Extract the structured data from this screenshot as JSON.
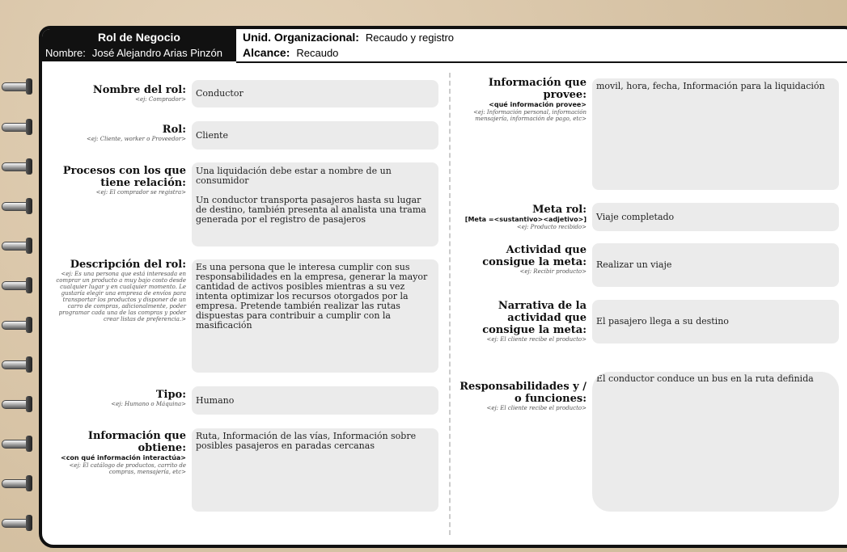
{
  "header": {
    "role_title": "Rol de Negocio",
    "name_label": "Nombre:",
    "name_value": "José Alejandro Arias Pinzón",
    "unit_label": "Unid. Organizacional:",
    "unit_value": "Recaudo y registro",
    "scope_label": "Alcance:",
    "scope_value": "Recaudo"
  },
  "left": {
    "nombre_rol": {
      "label": "Nombre del rol:",
      "example": "<ej: Comprador>",
      "value": "Conductor"
    },
    "rol": {
      "label": "Rol:",
      "example": "<ej: Cliente, worker  o Proveedor>",
      "value": "Cliente"
    },
    "procesos": {
      "label": "Procesos con los que tiene relación:",
      "example": "<ej: El comprador se registra>",
      "value": "Una liquidación debe estar a nombre de un consumidor\n\nUn conductor transporta pasajeros hasta su lugar de destino, también presenta al analista una trama generada por el registro de pasajeros"
    },
    "descripcion": {
      "label": "Descripción del rol:",
      "example": "<ej: Es una persona que está interesada en comprar un producto a muy bajo costo desde cualquier lugar y en cualquier momento. Le gustaría elegir una empresa de envíos para transportar los productos y disponer de un carro de compras, adicionalmente, poder programar cada una de las compras y poder crear listas de preferencia.>",
      "value": "Es una persona que le interesa cumplir con sus responsabilidades en la empresa, generar la mayor cantidad de activos posibles mientras a su vez intenta optimizar los recursos otorgados por la empresa. Pretende también realizar las rutas dispuestas para contribuir a cumplir con la masificación"
    },
    "tipo": {
      "label": "Tipo:",
      "example": "<ej: Humano o Máquina>",
      "value": "Humano"
    },
    "info_obtiene": {
      "label": "Información que obtiene:",
      "sub": "<con qué información interactúa>",
      "example": "<ej: El catálogo de productos, carrito de compras, mensajería, etc>",
      "value": "Ruta, Información de las vías, Información sobre posibles pasajeros en paradas cercanas"
    }
  },
  "right": {
    "info_provee": {
      "label": "Información que provee:",
      "sub": "<qué información provee>",
      "example": "<ej: Información personal, información mensajería, información de pago, etc>",
      "value": "movil, hora, fecha, Información para la liquidación"
    },
    "meta_rol": {
      "label": "Meta rol:",
      "sub": "[Meta =<sustantivo><adjetivo>]",
      "example": "<ej: Producto recibido>",
      "value": "Viaje completado"
    },
    "actividad": {
      "label": "Actividad que consigue la meta:",
      "example": "<ej: Recibir producto>",
      "value": "Realizar un  viaje"
    },
    "narrativa": {
      "label": "Narrativa de la actividad que consigue la meta:",
      "example": "<ej: El cliente recibe el producto>",
      "value": "El pasajero llega a su destino"
    },
    "responsabilidades": {
      "label": "Responsabilidades y / o funciones:",
      "example": "<ej: El cliente recibe el producto>",
      "value": "El conductor conduce un bus en la ruta definida"
    }
  }
}
